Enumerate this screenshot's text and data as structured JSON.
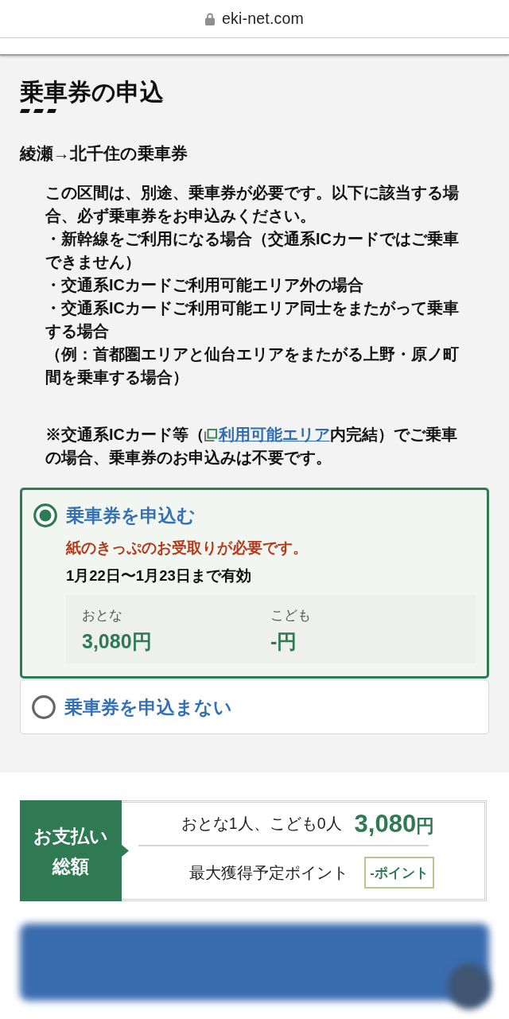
{
  "browser_bar": {
    "url": "eki-net.com",
    "secure": true
  },
  "page": {
    "title": "乗車券の申込",
    "route_heading": "綾瀬→北千住の乗車券",
    "notice": {
      "intro": "この区間は、別途、乗車券が必要です。以下に該当する場合、必ず乗車券をお申込みください。",
      "bullets": [
        "・新幹線をご利用になる場合（交通系ICカードではご乗車できません）",
        "・交通系ICカードご利用可能エリア外の場合",
        "・交通系ICカードご利用可能エリア同士をまたがって乗車する場合"
      ],
      "example": "（例：首都圏エリアと仙台エリアをまたがる上野・原ノ町間を乗車する場合）"
    },
    "note": {
      "before": "※交通系ICカード等（",
      "link": "利用可能エリア",
      "after": "内完結）でご乗車の場合、乗車券のお申込みは不要です。"
    },
    "options": [
      {
        "label": "乗車券を申込む",
        "selected": true,
        "warning": "紙のきっぷのお受取りが必要です。",
        "validity": "1月22日〜1月23日まで有効",
        "fares": [
          {
            "label": "おとな",
            "amount": "3,080円"
          },
          {
            "label": "こども",
            "amount": "-円"
          }
        ]
      },
      {
        "label": "乗車券を申込まない",
        "selected": false
      }
    ]
  },
  "summary": {
    "heading_lines": [
      "お支払い",
      "総額"
    ],
    "passengers": "おとな1人、こども0人",
    "total": "3,080",
    "total_unit": "円",
    "points_label": "最大獲得予定ポイント",
    "points": "-ポイント"
  }
}
